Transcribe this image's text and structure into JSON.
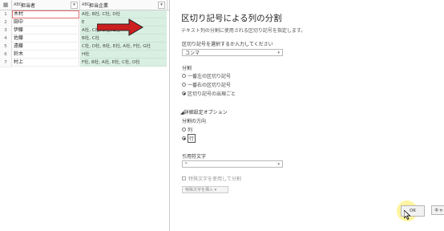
{
  "grid": {
    "columns": [
      {
        "type_icon": "ABC",
        "name": "担当者"
      },
      {
        "type_icon": "ABC",
        "name": "担当企業"
      }
    ],
    "rows": [
      {
        "num": "1",
        "person": "木村",
        "companies": "A社, B社, C社, D社"
      },
      {
        "num": "2",
        "person": "田中",
        "companies": "E"
      },
      {
        "num": "3",
        "person": "伊藤",
        "companies": "A社, C社, D社, E社"
      },
      {
        "num": "4",
        "person": "佐藤",
        "companies": "B社, C社"
      },
      {
        "num": "5",
        "person": "遠藤",
        "companies": "C社, D社, B社, E社, A社, F社, G社"
      },
      {
        "num": "6",
        "person": "鈴木",
        "companies": "H社"
      },
      {
        "num": "7",
        "person": "村上",
        "companies": "F社, B社, A社, E社, C社, D社"
      }
    ]
  },
  "dialog": {
    "title": "区切り記号による列の分割",
    "description": "テキスト列の分割に使用される区切り記号を指定します。",
    "delimiter_label": "区切り記号を選択するか入力してください",
    "delimiter_value": "コンマ",
    "split_label": "分割",
    "split_options": [
      "一番左の区切り記号",
      "一番右の区切り記号",
      "区切り記号の出現ごと"
    ],
    "advanced_label": "詳細設定オプション",
    "direction_label": "分割の方向",
    "direction_options": [
      "列",
      "行"
    ],
    "quote_label": "引用符文字",
    "quote_value": "\"",
    "special_checkbox_label": "特殊文字を使用して分割",
    "insert_special_label": "特殊文字を挿入",
    "ok_label": "OK",
    "cancel_label": "キャンセル"
  },
  "colors": {
    "highlight_column": "#d9efe2",
    "arrow": "#cc1f1f"
  }
}
